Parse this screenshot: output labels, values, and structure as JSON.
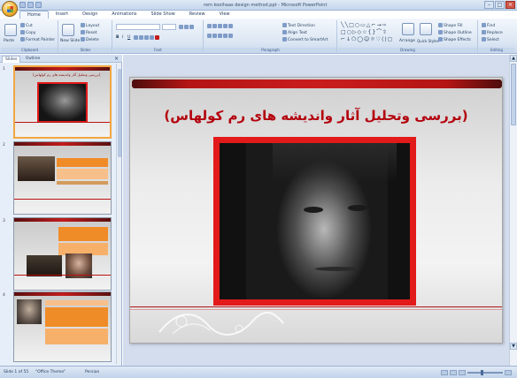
{
  "window": {
    "title": "rem koolhaas design method.ppt - Microsoft PowerPoint",
    "controls": [
      "–",
      "□",
      "×"
    ]
  },
  "ribbon": {
    "tabs": [
      "Home",
      "Insert",
      "Design",
      "Animations",
      "Slide Show",
      "Review",
      "View"
    ],
    "groups": {
      "clipboard": {
        "label": "Clipboard",
        "paste": "Paste",
        "cut": "Cut",
        "copy": "Copy",
        "format_painter": "Format Painter"
      },
      "slides": {
        "label": "Slides",
        "new_slide": "New Slide",
        "layout": "Layout",
        "reset": "Reset",
        "delete": "Delete"
      },
      "font": {
        "label": "Font",
        "font_name": "",
        "font_size": ""
      },
      "paragraph": {
        "label": "Paragraph",
        "text_direction": "Text Direction",
        "align_text": "Align Text",
        "convert_smartart": "Convert to SmartArt"
      },
      "drawing": {
        "label": "Drawing",
        "arrange": "Arrange",
        "quick_styles": "Quick Styles",
        "shape_fill": "Shape Fill",
        "shape_outline": "Shape Outline",
        "shape_effects": "Shape Effects"
      },
      "editing": {
        "label": "Editing",
        "find": "Find",
        "replace": "Replace",
        "select": "Select"
      }
    }
  },
  "panel": {
    "tabs": [
      "Slides",
      "Outline"
    ],
    "close": "×",
    "slides": [
      {
        "number": "1",
        "caption": "(بررسی وتحلیل آثار واندیشه های رم کولهاس)"
      },
      {
        "number": "2",
        "caption": ""
      },
      {
        "number": "3",
        "caption": ""
      },
      {
        "number": "4",
        "caption": ""
      }
    ]
  },
  "slide": {
    "title": "(بررسی وتحلیل آثار واندیشه های رم کولهاس)"
  },
  "status": {
    "slide_info": "Slide 1 of 55",
    "theme": "\"Office Theme\"",
    "language": "Persian"
  },
  "colors": {
    "accent_red": "#c91d1d",
    "title_red": "#b3000d",
    "photo_frame": "#e31a1a",
    "thumb_orange": "#f08c28",
    "selection": "#f3a642"
  }
}
